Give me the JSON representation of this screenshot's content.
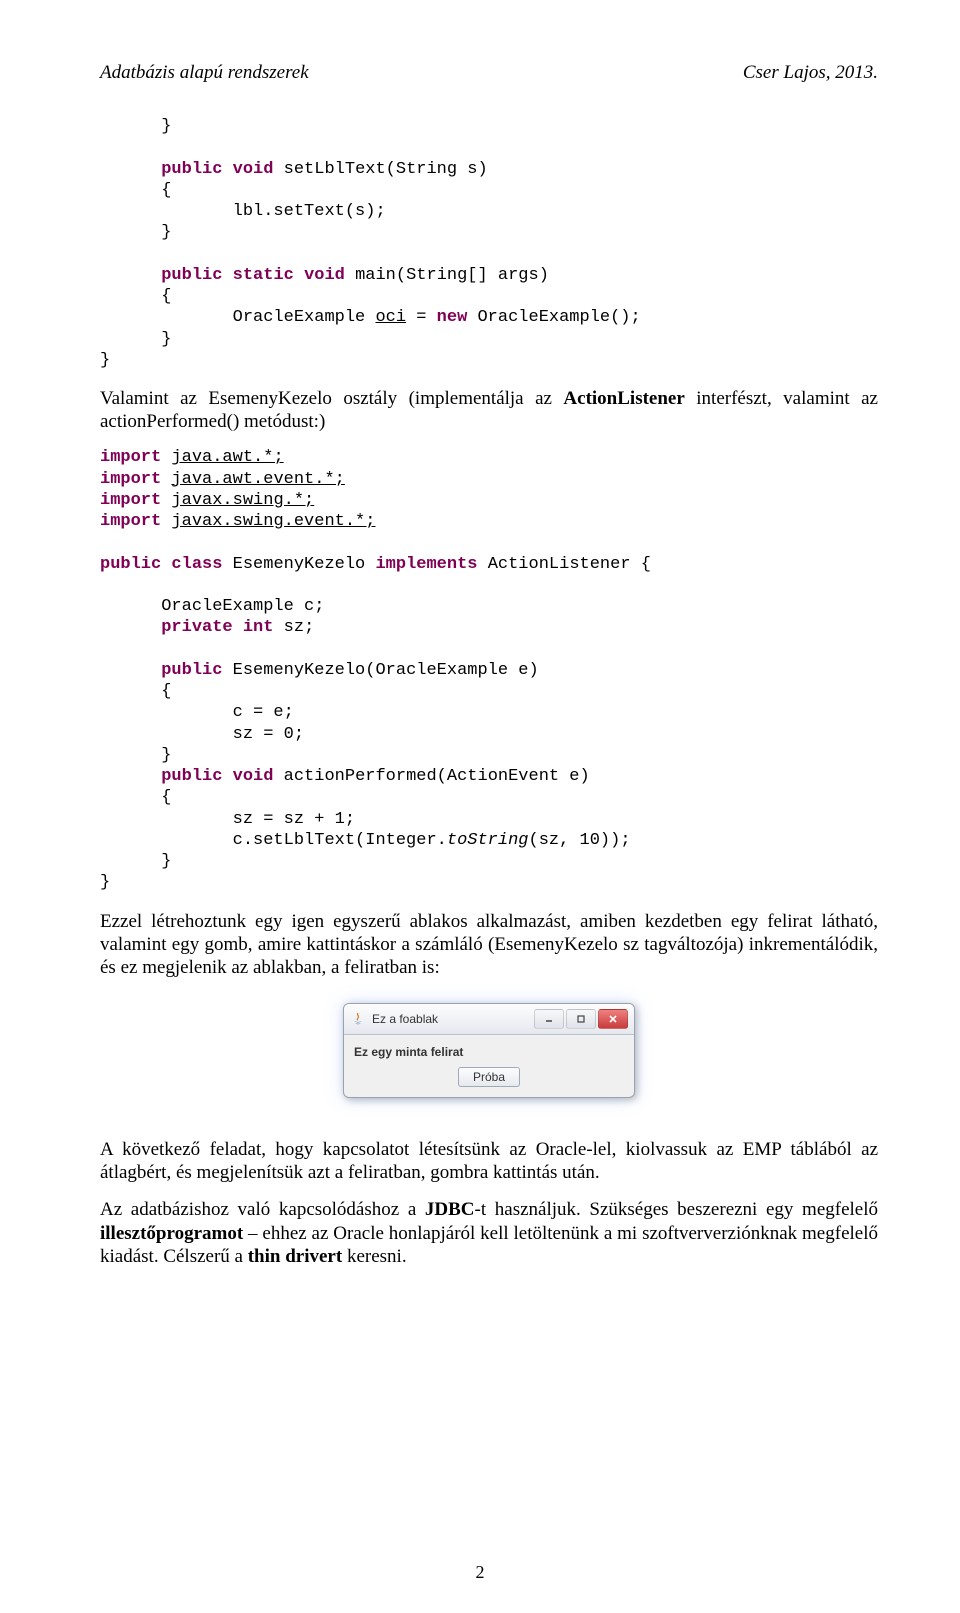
{
  "header": {
    "left": "Adatbázis alapú rendszerek",
    "right": "Cser Lajos, 2013."
  },
  "code1": {
    "l1": "}",
    "l2a": "public",
    "l2b": "void",
    "l2c": " setLblText(String s)",
    "l3": "{",
    "l4a": "lbl",
    "l4b": ".setText(s);",
    "l5": "}",
    "l6a": "public",
    "l6b": "static",
    "l6c": "void",
    "l6d": " main(String[] args)",
    "l7": "{",
    "l8a": "OracleExample ",
    "l8b": "oci",
    "l8c": " = ",
    "l8d": "new",
    "l8e": " OracleExample();",
    "l9": "}",
    "l10": "}"
  },
  "para1": {
    "a": "Valamint az EsemenyKezelo osztály (implementálja az ",
    "b": "ActionListener",
    "c": " interfészt, valamint az actionPerformed() metódust:)"
  },
  "code2": {
    "i1a": "import",
    "i1b": "java.awt.*;",
    "i2a": "import",
    "i2b": "java.awt.event.*;",
    "i3a": "import",
    "i3b": "javax.swing.*;",
    "i4a": "import",
    "i4b": "javax.swing.event.*;",
    "c1a": "public",
    "c1b": "class",
    "c1c": " EsemenyKezelo ",
    "c1d": "implements",
    "c1e": " ActionListener {",
    "f1a": "OracleExample ",
    "f1b": "c",
    "f1c": ";",
    "f2a": "private",
    "f2b": "int",
    "f2c": "sz",
    "f2d": ";",
    "m1a": "public",
    "m1b": " EsemenyKezelo(OracleExample e)",
    "m2": "{",
    "m3a": "c",
    "m3b": " = e;",
    "m4a": "sz",
    "m4b": " = 0;",
    "m5": "}",
    "m6a": "public",
    "m6b": "void",
    "m6c": " actionPerformed(ActionEvent e)",
    "m7": "{",
    "m8a": "sz",
    "m8b": " = ",
    "m8c": "sz",
    "m8d": " + 1;",
    "m9a": "c",
    "m9b": ".setLblText(Integer.",
    "m9c": "toString",
    "m9d": "(",
    "m9e": "sz",
    "m9f": ", 10));",
    "m10": "}",
    "m11": "}"
  },
  "para2": "Ezzel létrehoztunk egy igen egyszerű ablakos alkalmazást, amiben kezdetben egy felirat látható, valamint egy gomb, amire kattintáskor a számláló (EsemenyKezelo sz tagváltozója) inkrementálódik, és ez megjelenik az ablakban, a feliratban is:",
  "window": {
    "title": "Ez a foablak",
    "label": "Ez egy minta felirat",
    "button": "Próba"
  },
  "para3": "A következő feladat, hogy kapcsolatot létesítsünk az Oracle-lel, kiolvassuk az EMP táblából az átlagbért, és megjelenítsük azt a feliratban, gombra kattintás után.",
  "para4": {
    "a": "Az adatbázishoz való kapcsolódáshoz a ",
    "b": "JDBC",
    "c": "-t használjuk. Szükséges beszerezni egy megfelelő ",
    "d": "illesztőprogramot",
    "e": " – ehhez az Oracle honlapjáról kell letöltenünk a mi szoftververziónknak megfelelő kiadást. Célszerű a ",
    "f": "thin drivert",
    "g": " keresni."
  },
  "pageNumber": "2"
}
